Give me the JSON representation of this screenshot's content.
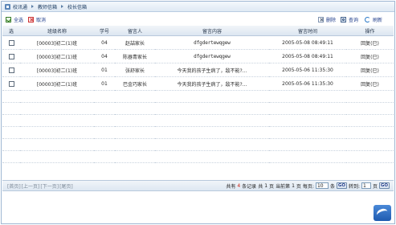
{
  "breadcrumb": [
    "校讯通",
    "教师信箱",
    "校长信箱"
  ],
  "toolbar": {
    "select_all": "全选",
    "cancel": "取消",
    "delete": "删除",
    "search": "查询",
    "refresh": "刷新"
  },
  "table": {
    "headers": [
      "选",
      "班级名称",
      "学号",
      "留言人",
      "留言内容",
      "留言时间",
      "操作"
    ],
    "rows": [
      {
        "class": "[00003]初二(1)班",
        "no": "04",
        "author": "赵喆家长",
        "content": "dfgdertewqgew",
        "time": "2005-05-08 08:49:11",
        "op": "回复(已)"
      },
      {
        "class": "[00003]初二(1)班",
        "no": "04",
        "author": "陈器青家长",
        "content": "dfgdertewqgew",
        "time": "2005-05-08 08:49:11",
        "op": "回复(已)"
      },
      {
        "class": "[00003]初二(1)班",
        "no": "01",
        "author": "张舒家长",
        "content": "今天我的孩子生病了，敌不能?...",
        "time": "2005-05-06 11:35:30",
        "op": "回复(已)"
      },
      {
        "class": "[00003]初二(1)班",
        "no": "01",
        "author": "巴金巧家长",
        "content": "今天我的孩子生病了，敌不能?...",
        "time": "2005-05-06 11:35:30",
        "op": "回复(已)"
      }
    ]
  },
  "pager": {
    "first": "[首页]",
    "prev": "[上一页]",
    "next": "[下一页]",
    "last": "[尾页]",
    "total_prefix": "共有",
    "total": "4",
    "total_suffix": "条记录",
    "pages_prefix": "共",
    "pages": "1",
    "pages_suffix": "页",
    "current_prefix": "当前第",
    "current": "1",
    "current_suffix": "页",
    "per_page_label": "每页:",
    "per_page": "10",
    "per_page_unit": "条",
    "go": "GO",
    "jump_label": "转到:",
    "jump_value": "1",
    "jump_unit": "页"
  },
  "colors": {
    "accent": "#1d3b8a",
    "header_bg": "#dce6f1",
    "border": "#9fb7d2"
  }
}
